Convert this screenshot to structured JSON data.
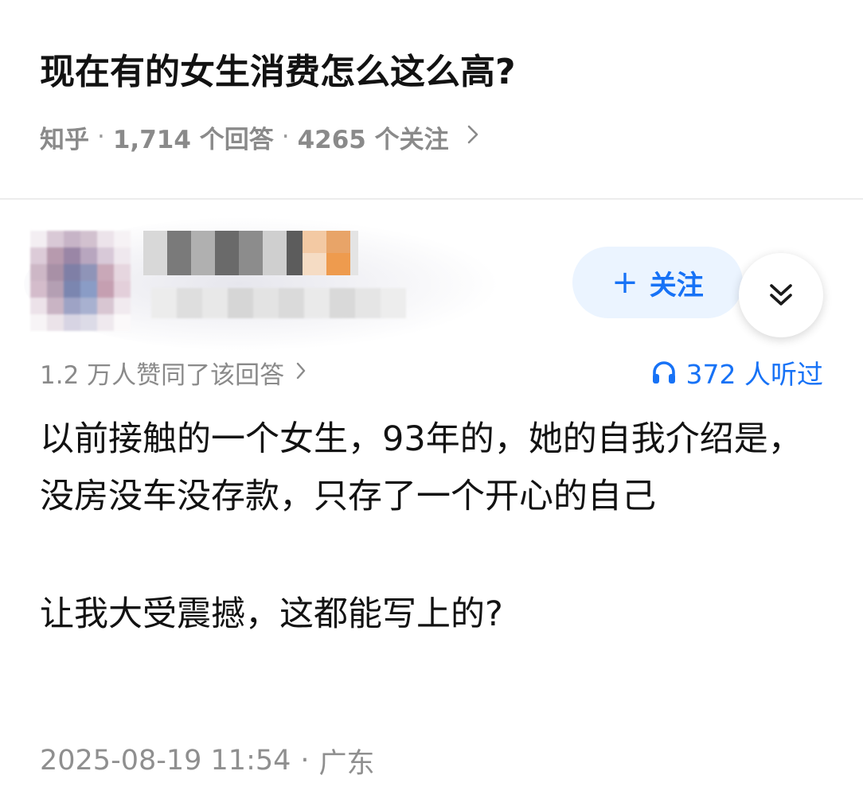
{
  "question": {
    "title": "现在有的女生消费怎么这么高?",
    "source": "知乎",
    "answers_count": "1,714 个回答",
    "followers_count": "4265 个关注"
  },
  "author": {
    "follow_label": "关注"
  },
  "answer": {
    "votes_text": "1.2 万人赞同了该回答",
    "listen_count": "372 人听过",
    "paragraphs": [
      "以前接触的一个女生，93年的，她的自我介绍是，没房没车没存款，只存了一个开心的自己",
      "让我大受震撼，这都能写上的?"
    ],
    "timestamp": "2025-08-19 11:54",
    "location": "广东"
  },
  "colors": {
    "accent": "#1772f6",
    "follow_bg": "#ebf4ff",
    "meta_gray": "#8a8a8a"
  },
  "icons": [
    "plus-icon",
    "double-chevron-down-icon",
    "headphones-icon",
    "chevron-right-icon"
  ]
}
